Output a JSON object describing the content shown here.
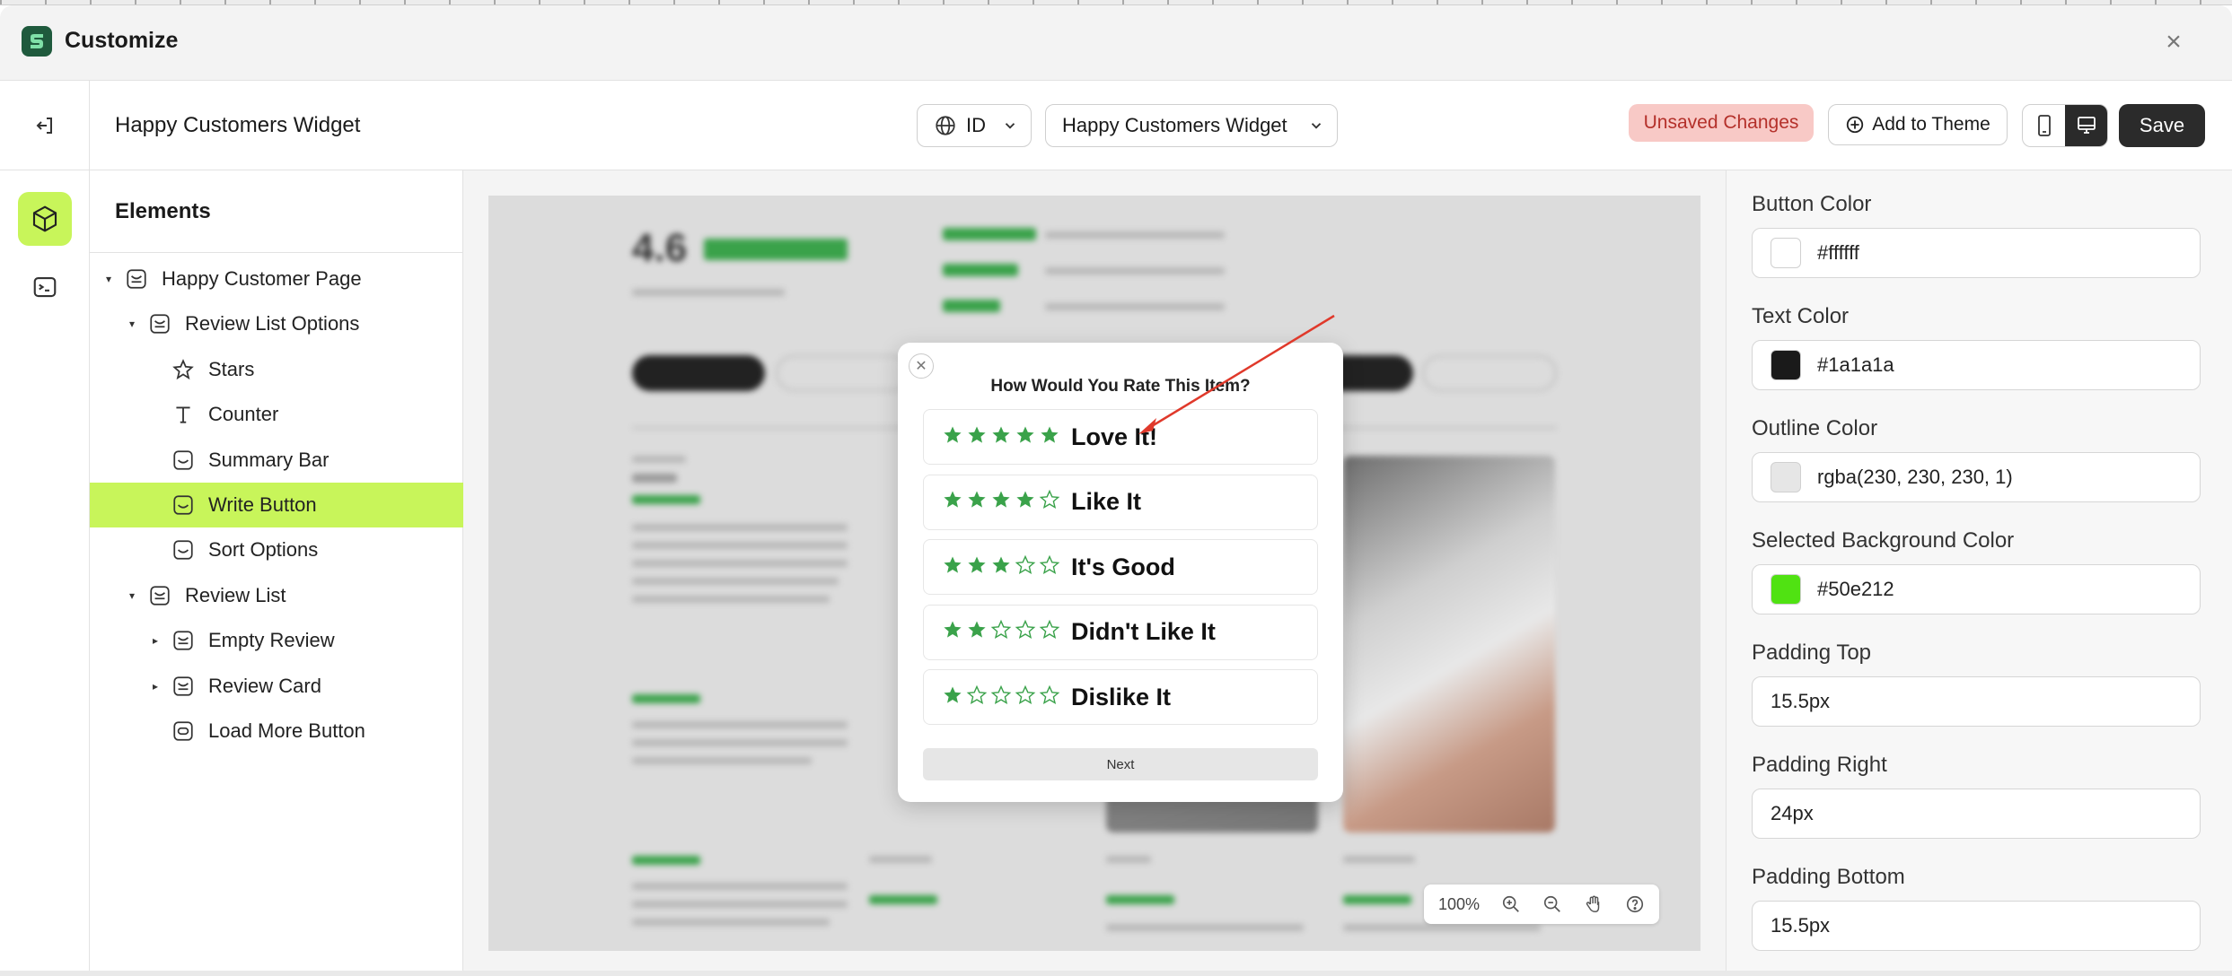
{
  "app": {
    "title": "Customize"
  },
  "toolbar": {
    "widget_title": "Happy Customers Widget",
    "language": "ID",
    "page_select": "Happy Customers Widget",
    "unsaved": "Unsaved Changes",
    "add_to_theme": "Add to Theme",
    "save": "Save"
  },
  "panel": {
    "heading": "Elements",
    "tree": [
      {
        "label": "Happy Customer Page",
        "depth": 0,
        "caret": "down",
        "icon": "section-icon"
      },
      {
        "label": "Review List Options",
        "depth": 1,
        "caret": "down",
        "icon": "section-icon"
      },
      {
        "label": "Stars",
        "depth": 2,
        "caret": "",
        "icon": "star-icon"
      },
      {
        "label": "Counter",
        "depth": 2,
        "caret": "",
        "icon": "text-icon"
      },
      {
        "label": "Summary Bar",
        "depth": 2,
        "caret": "",
        "icon": "block-icon"
      },
      {
        "label": "Write Button",
        "depth": 2,
        "caret": "",
        "icon": "block-icon",
        "active": true
      },
      {
        "label": "Sort Options",
        "depth": 2,
        "caret": "",
        "icon": "block-icon"
      },
      {
        "label": "Review List",
        "depth": 1,
        "caret": "down",
        "icon": "section-icon"
      },
      {
        "label": "Empty Review",
        "depth": 2,
        "caret": "right",
        "icon": "section-icon"
      },
      {
        "label": "Review Card",
        "depth": 2,
        "caret": "right",
        "icon": "section-icon"
      },
      {
        "label": "Load More Button",
        "depth": 2,
        "caret": "",
        "icon": "button-icon"
      }
    ]
  },
  "preview": {
    "rating": "4.6",
    "zoom": "100%",
    "modal": {
      "title": "How Would You Rate This Item?",
      "options": [
        {
          "label": "Love It!",
          "stars": 5
        },
        {
          "label": "Like It",
          "stars": 4
        },
        {
          "label": "It's Good",
          "stars": 3
        },
        {
          "label": "Didn't Like It",
          "stars": 2
        },
        {
          "label": "Dislike It",
          "stars": 1
        }
      ],
      "next": "Next"
    }
  },
  "props": [
    {
      "label": "Button Color",
      "value": "#ffffff",
      "swatch": "#ffffff"
    },
    {
      "label": "Text Color",
      "value": "#1a1a1a",
      "swatch": "#1a1a1a"
    },
    {
      "label": "Outline Color",
      "value": "rgba(230, 230, 230, 1)",
      "swatch": "#e6e6e6"
    },
    {
      "label": "Selected Background Color",
      "value": "#50e212",
      "swatch": "#50e212"
    },
    {
      "label": "Padding Top",
      "value": "15.5px"
    },
    {
      "label": "Padding Right",
      "value": "24px"
    },
    {
      "label": "Padding Bottom",
      "value": "15.5px"
    }
  ],
  "colors": {
    "accent": "#c8f55a",
    "star": "#3aa24a",
    "unsaved_bg": "#f8c9c6",
    "unsaved_text": "#b4302a",
    "arrow": "#e0392b"
  }
}
